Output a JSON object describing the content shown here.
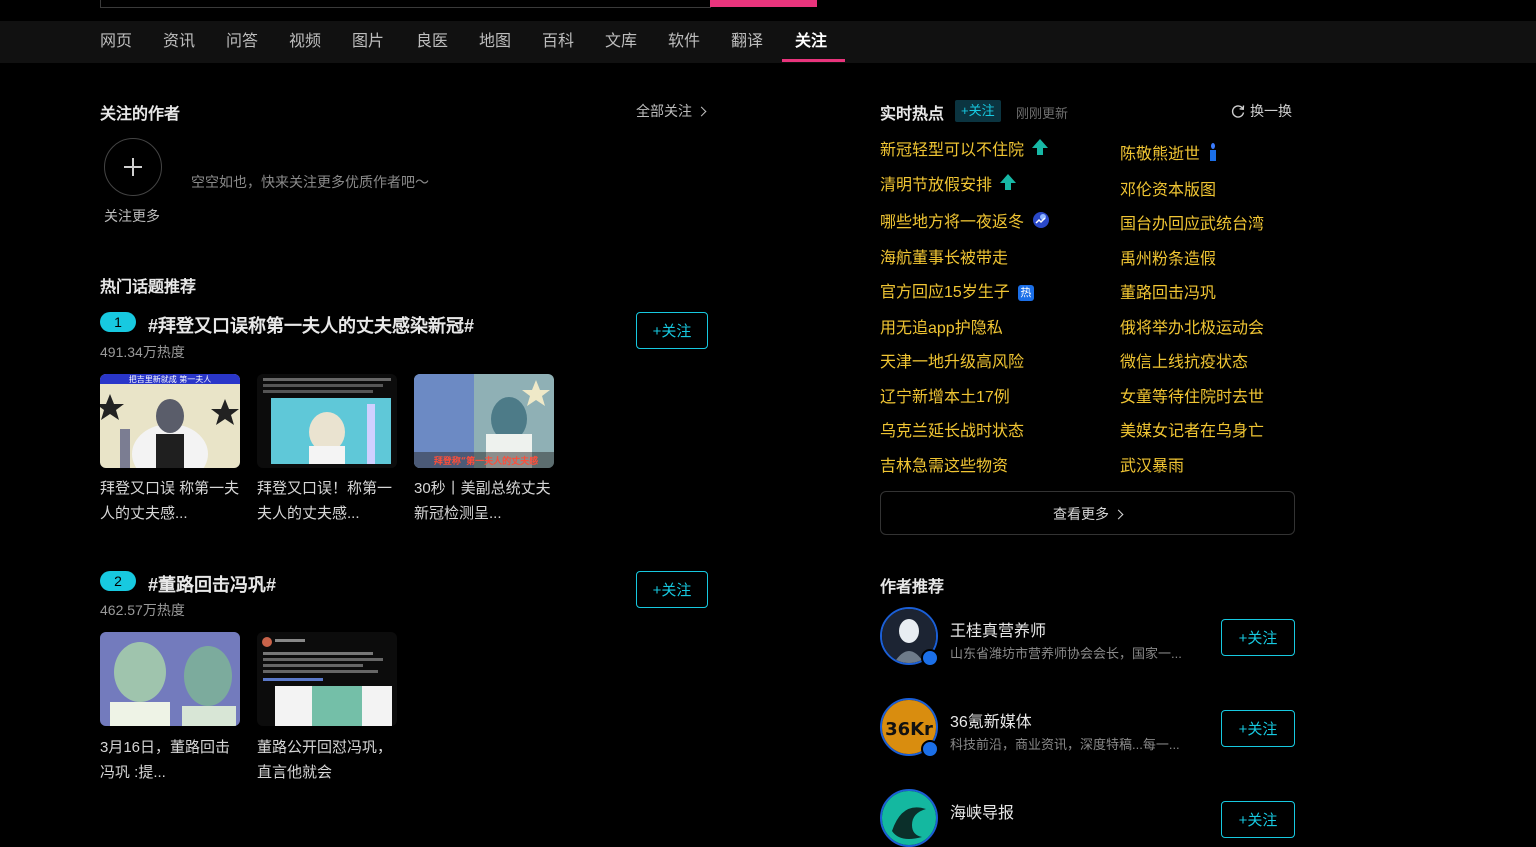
{
  "nav": {
    "items": [
      "网页",
      "资讯",
      "问答",
      "视频",
      "图片",
      "良医",
      "地图",
      "百科",
      "文库",
      "软件",
      "翻译",
      "关注"
    ],
    "active": "关注",
    "accent": "#e8347c"
  },
  "followed_authors": {
    "title": "关注的作者",
    "all_follow": "全部关注",
    "empty_text": "空空如也，快来关注更多优质作者吧～",
    "follow_more": "关注更多"
  },
  "hot_topics": {
    "title": "热门话题推荐",
    "follow_label": "+关注",
    "topics": [
      {
        "rank": "1",
        "title": "#拜登又口误称第一夫人的丈夫感染新冠#",
        "heat": "491.34万热度",
        "articles": [
          {
            "caption": "拜登又口误 称第一夫人的丈夫感...",
            "overlay": "把吉里新就成 第一夫人"
          },
          {
            "caption": "拜登又口误！称第一夫人的丈夫感..."
          },
          {
            "caption": "30秒丨美副总统丈夫新冠检测呈...",
            "overlay": "拜登称“第一夫人的丈夫感"
          }
        ]
      },
      {
        "rank": "2",
        "title": "#董路回击冯巩#",
        "heat": "462.57万热度",
        "articles": [
          {
            "caption": "3月16日，董路回击冯巩 :提..."
          },
          {
            "caption": "董路公开回怼冯巩，直言他就会"
          }
        ]
      }
    ]
  },
  "realtime_hot": {
    "title": "实时热点",
    "follow_tag": "+关注",
    "updated": "刚刚更新",
    "refresh": "换一换",
    "left": [
      {
        "text": "新冠轻型可以不住院",
        "icon": "rising-arrow-icon"
      },
      {
        "text": "清明节放假安排",
        "icon": "rising-arrow-icon"
      },
      {
        "text": "哪些地方将一夜返冬",
        "icon": "weather-icon"
      },
      {
        "text": "海航董事长被带走"
      },
      {
        "text": "官方回应15岁生子",
        "icon": "hot-badge-icon",
        "badge": "热"
      },
      {
        "text": "用无追app护隐私"
      },
      {
        "text": "天津一地升级高风险"
      },
      {
        "text": "辽宁新增本土17例"
      },
      {
        "text": "乌克兰延长战时状态"
      },
      {
        "text": "吉林急需这些物资"
      }
    ],
    "right": [
      {
        "text": "陈敬熊逝世",
        "icon": "candle-icon"
      },
      {
        "text": "邓伦资本版图"
      },
      {
        "text": "国台办回应武统台湾"
      },
      {
        "text": "禹州粉条造假"
      },
      {
        "text": "董路回击冯巩"
      },
      {
        "text": "俄将举办北极运动会"
      },
      {
        "text": "微信上线抗疫状态"
      },
      {
        "text": "女童等待住院时去世"
      },
      {
        "text": "美媒女记者在乌身亡"
      },
      {
        "text": "武汉暴雨"
      }
    ],
    "see_more": "查看更多"
  },
  "author_recs": {
    "title": "作者推荐",
    "follow_label": "+关注",
    "authors": [
      {
        "name": "王桂真营养师",
        "desc": "山东省潍坊市营养师协会会长，国家一..."
      },
      {
        "name": "36氪新媒体",
        "desc": "科技前沿，商业资讯，深度特稿...每一...",
        "logo_text": "36Kr"
      },
      {
        "name": "海峡导报",
        "desc": ""
      }
    ]
  },
  "colors": {
    "accent_pink": "#e8347c",
    "accent_cyan": "#17c9e0",
    "hot_yellow": "#f0c533"
  }
}
